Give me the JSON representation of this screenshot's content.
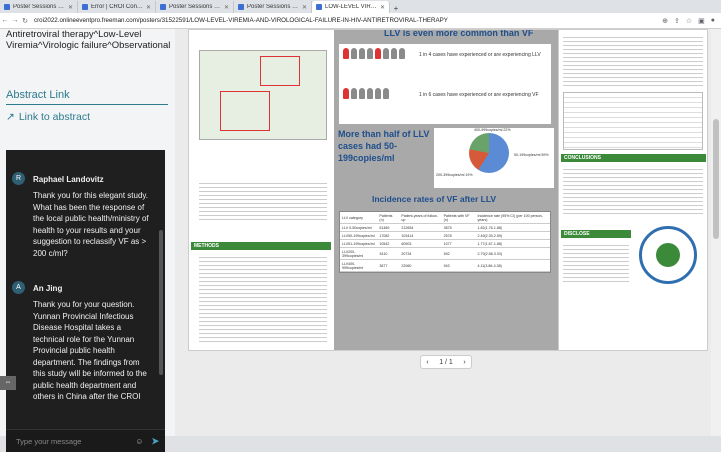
{
  "tabs": [
    {
      "label": "Poster Sessions for Wednesday"
    },
    {
      "label": "Error | CROI Conference 2022"
    },
    {
      "label": "Poster Sessions by Day.docx"
    },
    {
      "label": "Poster Sessions for Wednesday"
    },
    {
      "label": "LOW-LEVEL VIREMIA AND VIRO"
    }
  ],
  "url": "croi2022.onlineeventpro.freeman.com/posters/31522591/LOW-LEVEL-VIREMIA-AND-VIROLOGICAL-FAILURE-IN-HIV-ANTIRETROVIRAL-THERAPY",
  "left": {
    "title": "Antiretroviral therapy^Low-Level Viremia^Virologic failure^Observational",
    "abstract_heading": "Abstract Link",
    "abstract_link": "Link to abstract"
  },
  "chat": {
    "messages": [
      {
        "initial": "R",
        "name": "Raphael Landovitz",
        "text": "Thank you for this elegant study. What has been the response of the local public health/ministry of health to your results and your suggestion to reclassify VF as > 200 c/ml?"
      },
      {
        "initial": "A",
        "name": "An Jing",
        "text": "Thank you for your question. Yunnan Provincial Infectious Disease Hospital takes a technical role for the Yunnan Provincial public health department. The findings from this study will be informed to the public health department and others in China after the CROI"
      }
    ],
    "input_placeholder": "Type your message"
  },
  "poster": {
    "methods_heading": "METHODS",
    "big_title_partial": "LLV is even more common than VF",
    "llv_text": "1 in 4 cases have experienced or are experiencing LLV",
    "vf_text": "1 in 6 cases have experienced or are experiencing VF",
    "half_text": "More than half of LLV cases had 50-199copies/ml",
    "pie_labels": [
      "400-999copies/ml 22%",
      "50-199copies/ml 59%",
      "200-399copies/ml 19%"
    ],
    "incidence_title": "Incidence rates of VF after LLV",
    "conclusions_heading": "CONCLUSIONS",
    "disclose_heading": "DISCLOSE",
    "table_headers": [
      "LLV category",
      "Patients (n)",
      "Patient-years of follow-up",
      "Patients with VF (n)",
      "Incidence rate (95% CI) (per 100 person-years)"
    ],
    "table_rows": [
      [
        "LLV 0-50copies/ml",
        "51489",
        "212654",
        "3875",
        "1.82(1.76-1.88)"
      ],
      [
        "LLV50-199copies/ml",
        "17082",
        "103414",
        "2578",
        "2.49(2.39-2.59)"
      ],
      [
        "LLV51-199copies/ml",
        "10542",
        "60903",
        "1077",
        "1.77(1.67-1.88)"
      ],
      [
        "LLV200-399copies/ml",
        "3410",
        "20734",
        "592",
        "2.79(2.58-3.03)"
      ],
      [
        "LLV400-999copies/ml",
        "3877",
        "22060",
        "943",
        "4.11(3.86-4.38)"
      ]
    ]
  },
  "pager": {
    "label": "1 / 1"
  },
  "colors": {
    "accent": "#2c7a8c",
    "chat_bg": "#1f1f1f",
    "poster_section": "#3b8a3a",
    "poster_title": "#1e4e8c"
  }
}
